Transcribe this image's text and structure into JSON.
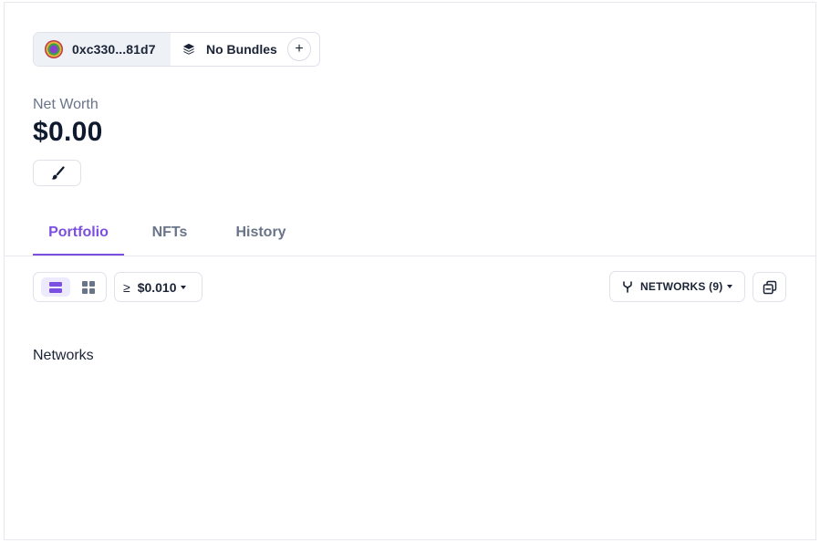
{
  "wallet": {
    "address": "0xc330...81d7"
  },
  "bundle": {
    "label": "No Bundles",
    "add_label": "+"
  },
  "net_worth": {
    "label": "Net Worth",
    "value": "$0.00"
  },
  "tabs": [
    {
      "label": "Portfolio",
      "active": true
    },
    {
      "label": "NFTs",
      "active": false
    },
    {
      "label": "History",
      "active": false
    }
  ],
  "toolbar": {
    "threshold_symbol": "≥",
    "threshold_value": "$0.010",
    "networks_label": "NETWORKS (9)"
  },
  "section": {
    "title": "Networks"
  },
  "colors": {
    "accent": "#7b4fe0",
    "text": "#1b2436",
    "muted": "#6a7489",
    "border": "#dfe2ea"
  },
  "icons": [
    "avatar",
    "layers-icon",
    "plus-icon",
    "brush-icon",
    "list-view-icon",
    "grid-view-icon",
    "chevron-down-icon",
    "fork-icon",
    "collapse-icon"
  ]
}
